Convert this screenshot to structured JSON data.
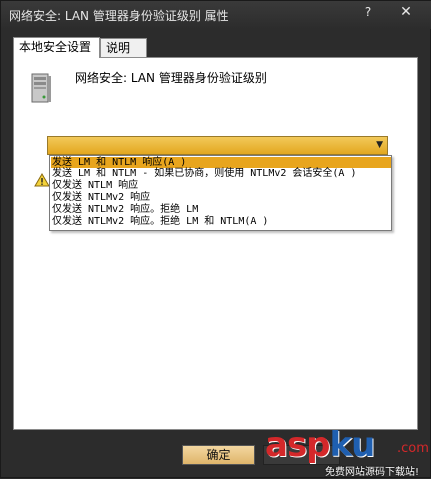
{
  "window": {
    "title": "网络安全: LAN 管理器身份验证级别 属性",
    "help_label": "?",
    "close_label": "✕"
  },
  "tabs": [
    {
      "label": "本地安全设置",
      "active": true
    },
    {
      "label": "说明",
      "active": false
    }
  ],
  "policy": {
    "icon": "server-icon",
    "title": "网络安全: LAN 管理器身份验证级别"
  },
  "combo": {
    "selected": "",
    "arrow_icon": "chevron-down-icon"
  },
  "dropdown": {
    "options": [
      "发送 LM 和 NTLM 响应(A )",
      "发送 LM 和 NTLM - 如果已协商，则使用 NTLMv2 会话安全(A )",
      "仅发送 NTLM 响应",
      "仅发送 NTLMv2 响应",
      "仅发送 NTLMv2 响应。拒绝 LM",
      "仅发送 NTLMv2 响应。拒绝 LM 和 NTLM(A )"
    ],
    "highlighted_index": 0
  },
  "warning": {
    "icon": "warning-icon"
  },
  "buttons": {
    "ok": "确定",
    "cancel": ""
  },
  "watermark": {
    "brand_red": "asp",
    "brand_blue": "ku",
    "tld": ".com",
    "tagline": "免费网站源码下载站!"
  },
  "colors": {
    "accent": "#e8a51d",
    "titlebar": "#2c2c2c",
    "watermark_red": "#d4282a",
    "watermark_blue": "#1f5fb0"
  }
}
